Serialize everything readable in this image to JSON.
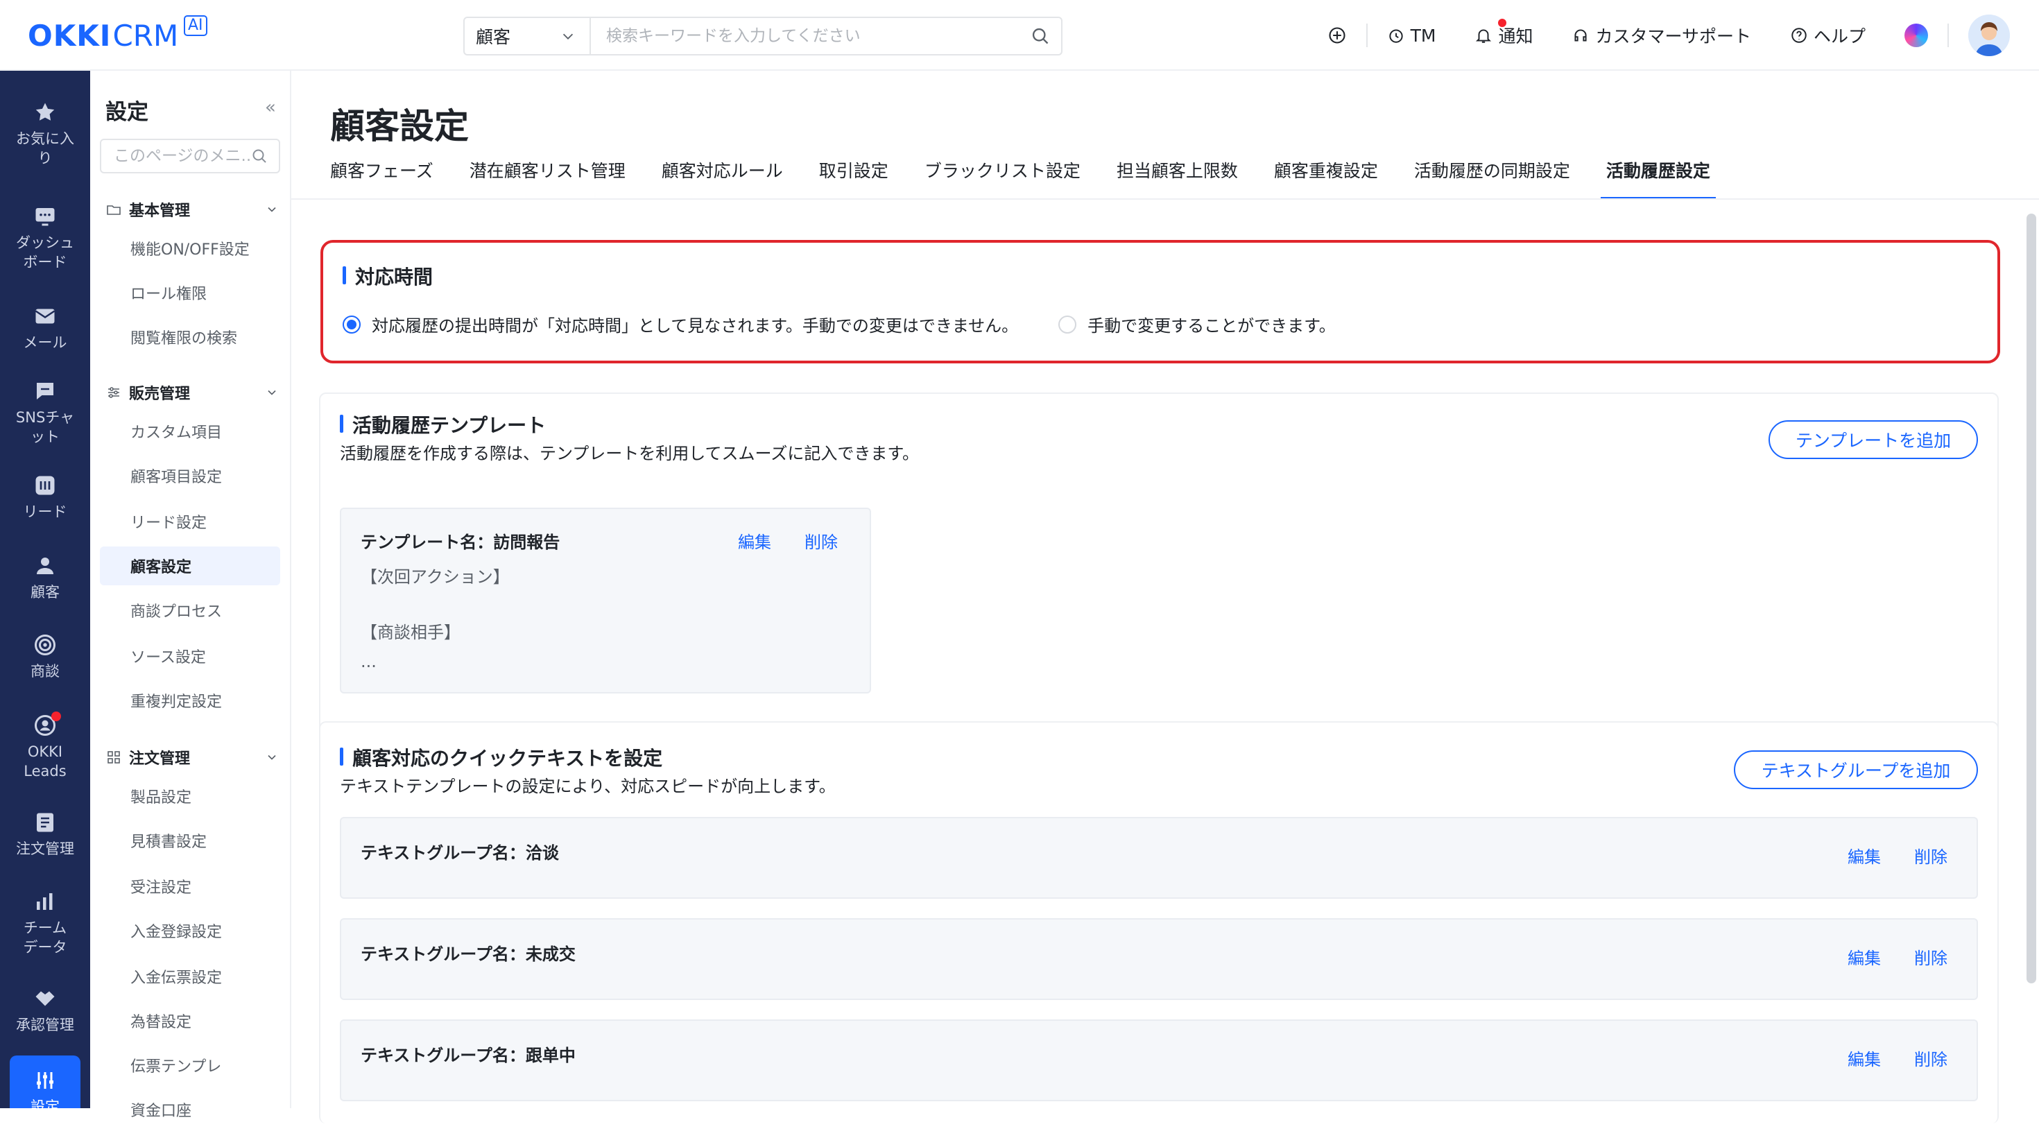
{
  "brand": {
    "okki": "OKKI",
    "crm": "CRM",
    "ai": "AI"
  },
  "search": {
    "scope": "顧客",
    "placeholder": "検索キーワードを入力してください"
  },
  "topbar": {
    "tm": "TM",
    "notify": "通知",
    "support": "カスタマーサポート",
    "help": "ヘルプ"
  },
  "leftnav": [
    {
      "label": "お気に入り"
    },
    {
      "label": "ダッシュボード"
    },
    {
      "label": "メール"
    },
    {
      "label": "SNSチャット"
    },
    {
      "label": "リード"
    },
    {
      "label": "顧客"
    },
    {
      "label": "商談"
    },
    {
      "label": "OKKI Leads"
    },
    {
      "label": "注文管理"
    },
    {
      "label": "チームデータ"
    },
    {
      "label": "承認管理"
    },
    {
      "label": "設定"
    }
  ],
  "submenu": {
    "title": "設定",
    "collapse": "«",
    "search_placeholder": "このページのメニ...",
    "groups": [
      {
        "label": "基本管理",
        "items": [
          "機能ON/OFF設定",
          "ロール権限",
          "閲覧権限の検索"
        ]
      },
      {
        "label": "販売管理",
        "items": [
          "カスタム項目",
          "顧客項目設定",
          "リード設定",
          "顧客設定",
          "商談プロセス",
          "ソース設定",
          "重複判定設定"
        ]
      },
      {
        "label": "注文管理",
        "items": [
          "製品設定",
          "見積書設定",
          "受注設定",
          "入金登録設定",
          "入金伝票設定",
          "為替設定",
          "伝票テンプレ",
          "資金口座"
        ]
      }
    ]
  },
  "page": {
    "title": "顧客設定",
    "tabs": [
      "顧客フェーズ",
      "潜在顧客リスト管理",
      "顧客対応ルール",
      "取引設定",
      "ブラックリスト設定",
      "担当顧客上限数",
      "顧客重複設定",
      "活動履歴の同期設定",
      "活動履歴設定"
    ],
    "active_tab": "活動履歴設定"
  },
  "response_time": {
    "title": "対応時間",
    "option1": "対応履歴の提出時間が「対応時間」として見なされます。手動での変更はできません。",
    "option2": "手動で変更することができます。",
    "selected": "option1"
  },
  "template": {
    "title": "活動履歴テンプレート",
    "desc": "活動履歴を作成する際は、テンプレートを利用してスムーズに記入できます。",
    "add_button": "テンプレートを追加",
    "item": {
      "name": "テンプレート名：訪問報告",
      "edit": "編集",
      "delete": "削除",
      "lines": [
        "【次回アクション】",
        "【商談相手】",
        "..."
      ]
    }
  },
  "quicktext": {
    "title": "顧客対応のクイックテキストを設定",
    "desc": "テキストテンプレートの設定により、対応スピードが向上します。",
    "add_button": "テキストグループを追加",
    "groups": [
      {
        "name": "テキストグループ名：洽谈",
        "edit": "編集",
        "delete": "削除"
      },
      {
        "name": "テキストグループ名：未成交",
        "edit": "編集",
        "delete": "削除"
      },
      {
        "name": "テキストグループ名：跟单中",
        "edit": "編集",
        "delete": "削除"
      }
    ]
  },
  "colors": {
    "primary": "#1a66ff",
    "nav_bg": "#1d2a56",
    "highlight": "#e0262c"
  }
}
